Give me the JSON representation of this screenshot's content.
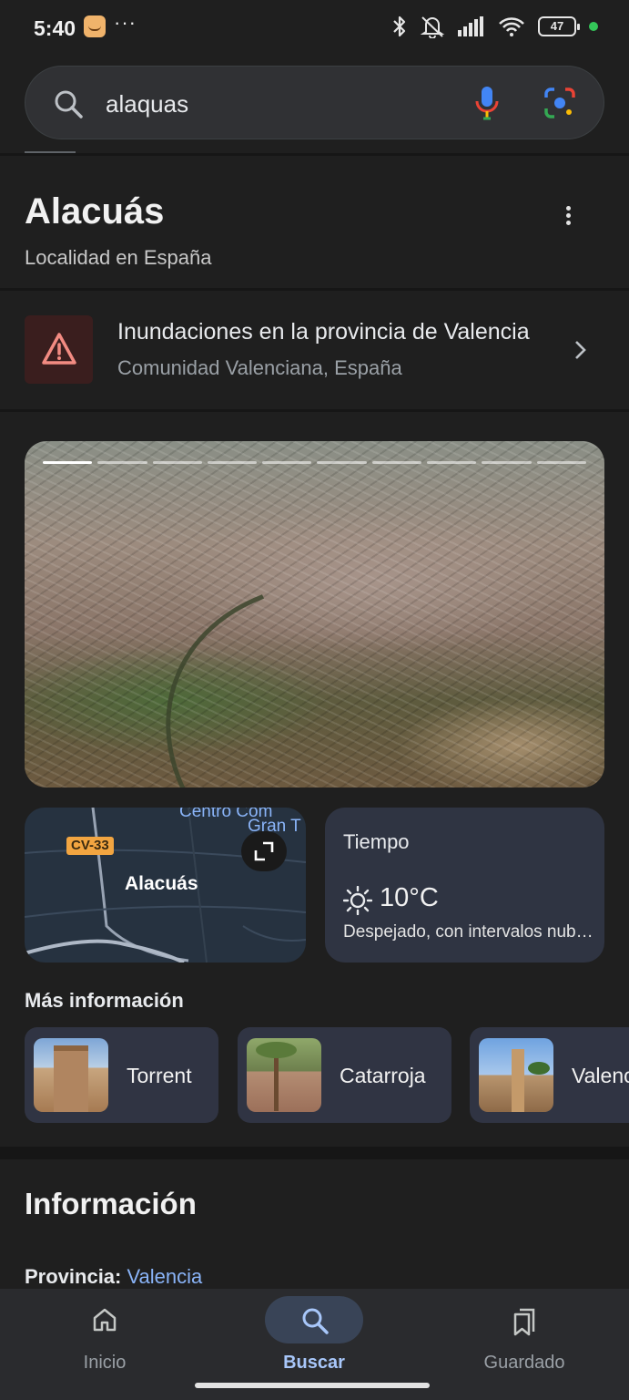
{
  "status_bar": {
    "time": "5:40",
    "notification_dots": "···",
    "battery": "47",
    "icons": [
      "bluetooth-icon",
      "muted-bell-icon",
      "signal-icon",
      "wifi-icon",
      "battery-icon"
    ]
  },
  "search": {
    "query": "alaquas",
    "icons": [
      "search-icon",
      "mic-icon",
      "lens-icon"
    ]
  },
  "entity": {
    "title": "Alacuás",
    "subtitle": "Localidad en España"
  },
  "alert": {
    "title": "Inundaciones en la provincia de Valencia",
    "subtitle": "Comunidad Valenciana, España",
    "accent_color": "#f28b82"
  },
  "hero": {
    "slides_total": 10,
    "active_slide": 1
  },
  "map": {
    "road_badge": "CV-33",
    "poi_line1": "Centro Com",
    "poi_line2": "Gran T",
    "town_label": "Alacuás"
  },
  "weather": {
    "title": "Tiempo",
    "temperature": "10°C",
    "description": "Despejado, con intervalos nubosos",
    "icon": "sun-icon"
  },
  "more_info": {
    "title": "Más información",
    "chips": [
      {
        "label": "Torrent"
      },
      {
        "label": "Catarroja"
      },
      {
        "label": "Valencia"
      }
    ]
  },
  "info": {
    "title": "Información",
    "province_label": "Provincia:",
    "province_value": "Valencia"
  },
  "bottom_nav": {
    "items": [
      {
        "label": "Inicio",
        "icon": "home-icon"
      },
      {
        "label": "Buscar",
        "icon": "search-icon",
        "active": true
      },
      {
        "label": "Guardado",
        "icon": "saved-icon"
      }
    ]
  },
  "colors": {
    "background": "#1f1f1f",
    "link": "#8ab4f8",
    "active_nav": "#a8c7fa"
  }
}
